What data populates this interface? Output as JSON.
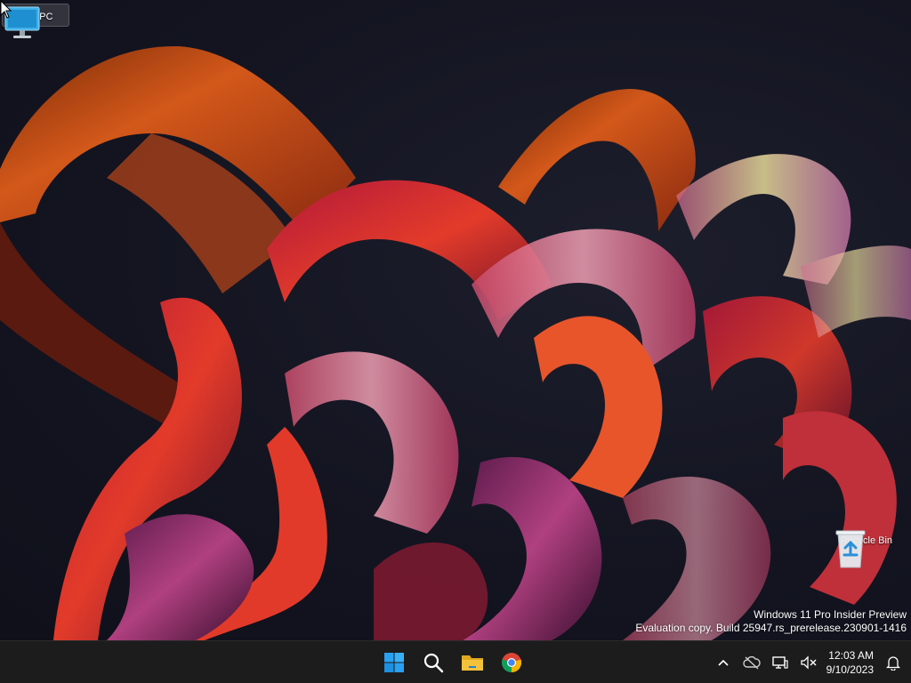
{
  "desktop": {
    "icons": [
      {
        "label": "This PC",
        "icon": "computer-monitor-icon"
      },
      {
        "label": "Recycle Bin",
        "icon": "recycle-bin-icon"
      }
    ],
    "watermark": {
      "line1": "Windows 11 Pro Insider Preview",
      "line2": "Evaluation copy. Build 25947.rs_prerelease.230901-1416"
    }
  },
  "taskbar": {
    "apps": [
      {
        "name": "Start",
        "icon": "windows-start-icon"
      },
      {
        "name": "Search",
        "icon": "search-icon"
      },
      {
        "name": "File Explorer",
        "icon": "folder-icon"
      },
      {
        "name": "Google Chrome",
        "icon": "chrome-icon"
      }
    ],
    "tray": {
      "icons": [
        "chevron-up-icon",
        "cloud-offline-icon",
        "network-icon",
        "volume-muted-icon"
      ],
      "time": "12:03 AM",
      "date": "9/10/2023"
    }
  },
  "colors": {
    "taskbar_bg": "#1c1c1c",
    "windows_blue": "#2aa0f0",
    "folder_yellow": "#f3c23b"
  }
}
